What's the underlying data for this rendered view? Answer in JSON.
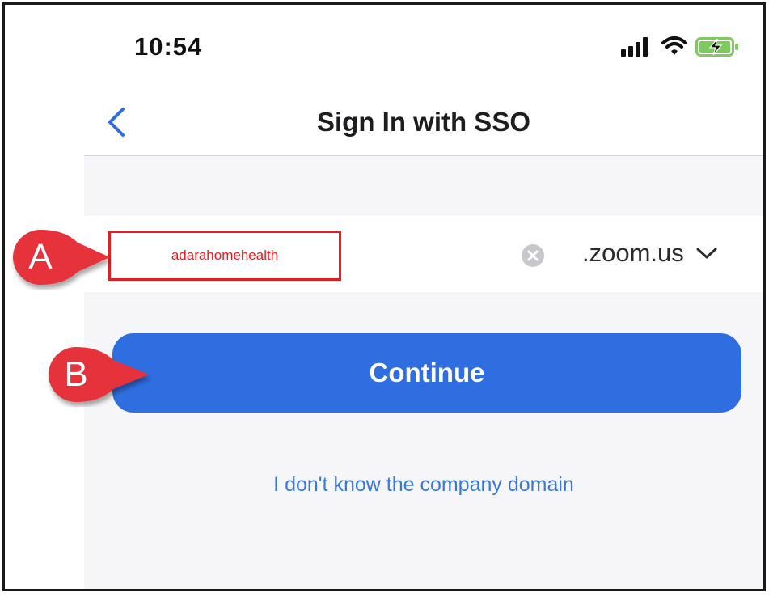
{
  "status_bar": {
    "time": "10:54",
    "icons": [
      "signal-icon",
      "wifi-icon",
      "battery-charging-icon"
    ]
  },
  "nav": {
    "title": "Sign In with SSO",
    "back_icon": "chevron-left-icon"
  },
  "domain_form": {
    "input_value": "adarahomehealth",
    "domain_suffix": ".zoom.us",
    "clear_icon": "clear-icon",
    "dropdown_icon": "chevron-down-icon"
  },
  "continue_label": "Continue",
  "help_link": "I don't know the company domain",
  "callouts": {
    "a": "A",
    "b": "B"
  },
  "colors": {
    "accent": "#2f6ee0",
    "link": "#3b79d8",
    "callout": "#e5323a",
    "highlight_border": "#e21d23"
  }
}
